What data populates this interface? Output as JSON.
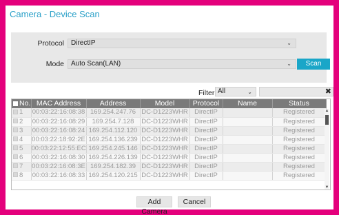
{
  "dialog": {
    "title": "Camera - Device Scan"
  },
  "scan": {
    "protocol_label": "Protocol",
    "protocol_value": "DirectIP",
    "mode_label": "Mode",
    "mode_value": "Auto Scan(LAN)",
    "scan_button": "Scan",
    "caret": "⌄"
  },
  "filter": {
    "label": "Filter",
    "value": "All",
    "clear_icon": "✖"
  },
  "table": {
    "columns": [
      "No.",
      "MAC Address",
      "Address",
      "Model",
      "Protocol",
      "Name",
      "Status"
    ],
    "rows": [
      {
        "no": "1",
        "mac": "00:03:22:16:08:38",
        "address": "169.254.247.76",
        "model": "DC-D1223WHR",
        "protocol": "DirectIP",
        "name": "",
        "status": "Registered"
      },
      {
        "no": "2",
        "mac": "00:03:22:16:08:29",
        "address": "169.254.7.128",
        "model": "DC-D1223WHR",
        "protocol": "DirectIP",
        "name": "",
        "status": "Registered"
      },
      {
        "no": "3",
        "mac": "00:03:22:16:08:24",
        "address": "169.254.112.120",
        "model": "DC-D1223WHR",
        "protocol": "DirectIP",
        "name": "",
        "status": "Registered"
      },
      {
        "no": "4",
        "mac": "00:03:22:18:92:2E",
        "address": "169.254.136.239",
        "model": "DC-D1223WHR",
        "protocol": "DirectIP",
        "name": "",
        "status": "Registered"
      },
      {
        "no": "5",
        "mac": "00:03:22:12:55:EC",
        "address": "169.254.245.146",
        "model": "DC-D1223WHR",
        "protocol": "DirectIP",
        "name": "",
        "status": "Registered"
      },
      {
        "no": "6",
        "mac": "00:03:22:16:08:30",
        "address": "169.254.226.139",
        "model": "DC-D1223WHR",
        "protocol": "DirectIP",
        "name": "",
        "status": "Registered"
      },
      {
        "no": "7",
        "mac": "00:03:22:16:08:3E",
        "address": "169.254.182.39",
        "model": "DC-D1223WHR",
        "protocol": "DirectIP",
        "name": "",
        "status": "Registered"
      },
      {
        "no": "8",
        "mac": "00:03:22:16:08:33",
        "address": "169.254.120.215",
        "model": "DC-D1223WHR",
        "protocol": "DirectIP",
        "name": "",
        "status": "Registered"
      }
    ]
  },
  "scrollbar": {
    "up_icon": "▲",
    "down_icon": "▼"
  },
  "footer": {
    "add_camera": "Add Camera",
    "cancel": "Cancel"
  },
  "colors": {
    "frame": "#e4007c",
    "accent": "#1aa6c8",
    "title": "#2aa0c8",
    "header_bg": "#7a7a7a"
  }
}
